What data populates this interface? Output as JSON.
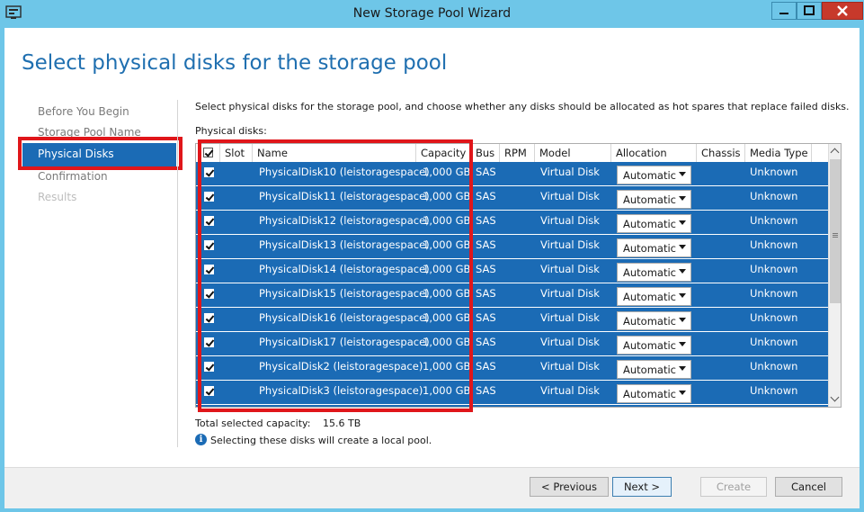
{
  "window": {
    "title": "New Storage Pool Wizard",
    "controls": [
      "minimize",
      "maximize",
      "close"
    ]
  },
  "page": {
    "heading": "Select physical disks for the storage pool",
    "description": "Select physical disks for the storage pool, and choose whether any disks should be allocated as hot spares that replace failed disks.",
    "disks_label": "Physical disks:"
  },
  "nav": {
    "items": [
      {
        "label": "Before You Begin",
        "state": "visited"
      },
      {
        "label": "Storage Pool Name",
        "state": "visited"
      },
      {
        "label": "Physical Disks",
        "state": "selected"
      },
      {
        "label": "Confirmation",
        "state": "visited"
      },
      {
        "label": "Results",
        "state": "disabled"
      }
    ]
  },
  "grid": {
    "columns": [
      "Slot",
      "Name",
      "Capacity",
      "Bus",
      "RPM",
      "Model",
      "Allocation",
      "Chassis",
      "Media Type"
    ],
    "rows": [
      {
        "checked": true,
        "slot": "",
        "name": "PhysicalDisk10 (leistoragespace)",
        "capacity": "1,000 GB",
        "bus": "SAS",
        "rpm": "",
        "model": "Virtual Disk",
        "allocation": "Automatic",
        "chassis": "",
        "media": "Unknown"
      },
      {
        "checked": true,
        "slot": "",
        "name": "PhysicalDisk11 (leistoragespace)",
        "capacity": "1,000 GB",
        "bus": "SAS",
        "rpm": "",
        "model": "Virtual Disk",
        "allocation": "Automatic",
        "chassis": "",
        "media": "Unknown"
      },
      {
        "checked": true,
        "slot": "",
        "name": "PhysicalDisk12 (leistoragespace)",
        "capacity": "1,000 GB",
        "bus": "SAS",
        "rpm": "",
        "model": "Virtual Disk",
        "allocation": "Automatic",
        "chassis": "",
        "media": "Unknown"
      },
      {
        "checked": true,
        "slot": "",
        "name": "PhysicalDisk13 (leistoragespace)",
        "capacity": "1,000 GB",
        "bus": "SAS",
        "rpm": "",
        "model": "Virtual Disk",
        "allocation": "Automatic",
        "chassis": "",
        "media": "Unknown"
      },
      {
        "checked": true,
        "slot": "",
        "name": "PhysicalDisk14 (leistoragespace)",
        "capacity": "1,000 GB",
        "bus": "SAS",
        "rpm": "",
        "model": "Virtual Disk",
        "allocation": "Automatic",
        "chassis": "",
        "media": "Unknown"
      },
      {
        "checked": true,
        "slot": "",
        "name": "PhysicalDisk15 (leistoragespace)",
        "capacity": "1,000 GB",
        "bus": "SAS",
        "rpm": "",
        "model": "Virtual Disk",
        "allocation": "Automatic",
        "chassis": "",
        "media": "Unknown"
      },
      {
        "checked": true,
        "slot": "",
        "name": "PhysicalDisk16 (leistoragespace)",
        "capacity": "1,000 GB",
        "bus": "SAS",
        "rpm": "",
        "model": "Virtual Disk",
        "allocation": "Automatic",
        "chassis": "",
        "media": "Unknown"
      },
      {
        "checked": true,
        "slot": "",
        "name": "PhysicalDisk17 (leistoragespace)",
        "capacity": "1,000 GB",
        "bus": "SAS",
        "rpm": "",
        "model": "Virtual Disk",
        "allocation": "Automatic",
        "chassis": "",
        "media": "Unknown"
      },
      {
        "checked": true,
        "slot": "",
        "name": "PhysicalDisk2 (leistoragespace)",
        "capacity": "1,000 GB",
        "bus": "SAS",
        "rpm": "",
        "model": "Virtual Disk",
        "allocation": "Automatic",
        "chassis": "",
        "media": "Unknown"
      },
      {
        "checked": true,
        "slot": "",
        "name": "PhysicalDisk3 (leistoragespace)",
        "capacity": "1,000 GB",
        "bus": "SAS",
        "rpm": "",
        "model": "Virtual Disk",
        "allocation": "Automatic",
        "chassis": "",
        "media": "Unknown"
      }
    ]
  },
  "summary": {
    "total_label": "Total selected capacity:",
    "total_value": "15.6 TB",
    "info_text": "Selecting these disks will create a local pool."
  },
  "buttons": {
    "previous": "< Previous",
    "next": "Next >",
    "create": "Create",
    "cancel": "Cancel"
  },
  "colors": {
    "title_bar": "#6ec6e8",
    "selection": "#1b6bb5",
    "heading": "#1f6fb0",
    "highlight_box": "#e0161a"
  },
  "icons": {
    "app": "server-manager-icon",
    "info": "info-icon"
  }
}
